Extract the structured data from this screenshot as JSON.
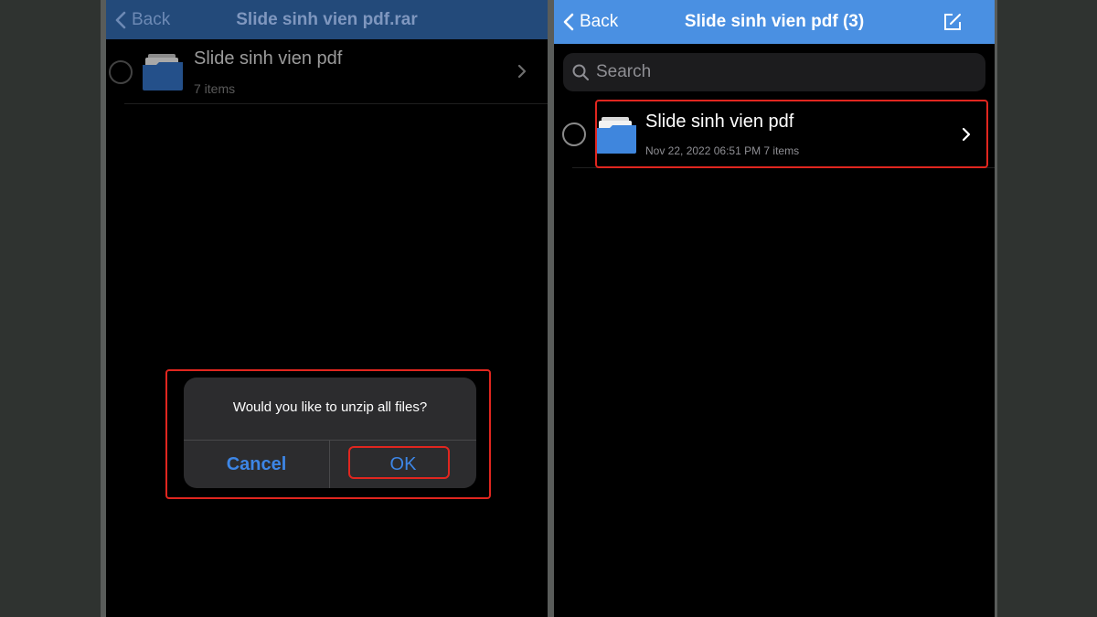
{
  "left_screen": {
    "navbar": {
      "back_label": "Back",
      "title": "Slide sinh vien pdf.rar",
      "color": "#234a7a"
    },
    "row": {
      "title": "Slide sinh vien pdf",
      "subtitle": "7 items",
      "icon": "folder-icon"
    },
    "dialog": {
      "message": "Would you like to unzip all files?",
      "cancel_label": "Cancel",
      "ok_label": "OK",
      "highlight_color": "#e0261f"
    }
  },
  "right_screen": {
    "navbar": {
      "back_label": "Back",
      "title": "Slide sinh vien pdf (3)",
      "color": "#4a90e2",
      "edit_icon": "compose-icon"
    },
    "search": {
      "placeholder": "Search",
      "value": ""
    },
    "row": {
      "title": "Slide sinh vien pdf",
      "subtitle": "Nov 22, 2022 06:51 PM  7 items",
      "icon": "folder-icon"
    }
  }
}
